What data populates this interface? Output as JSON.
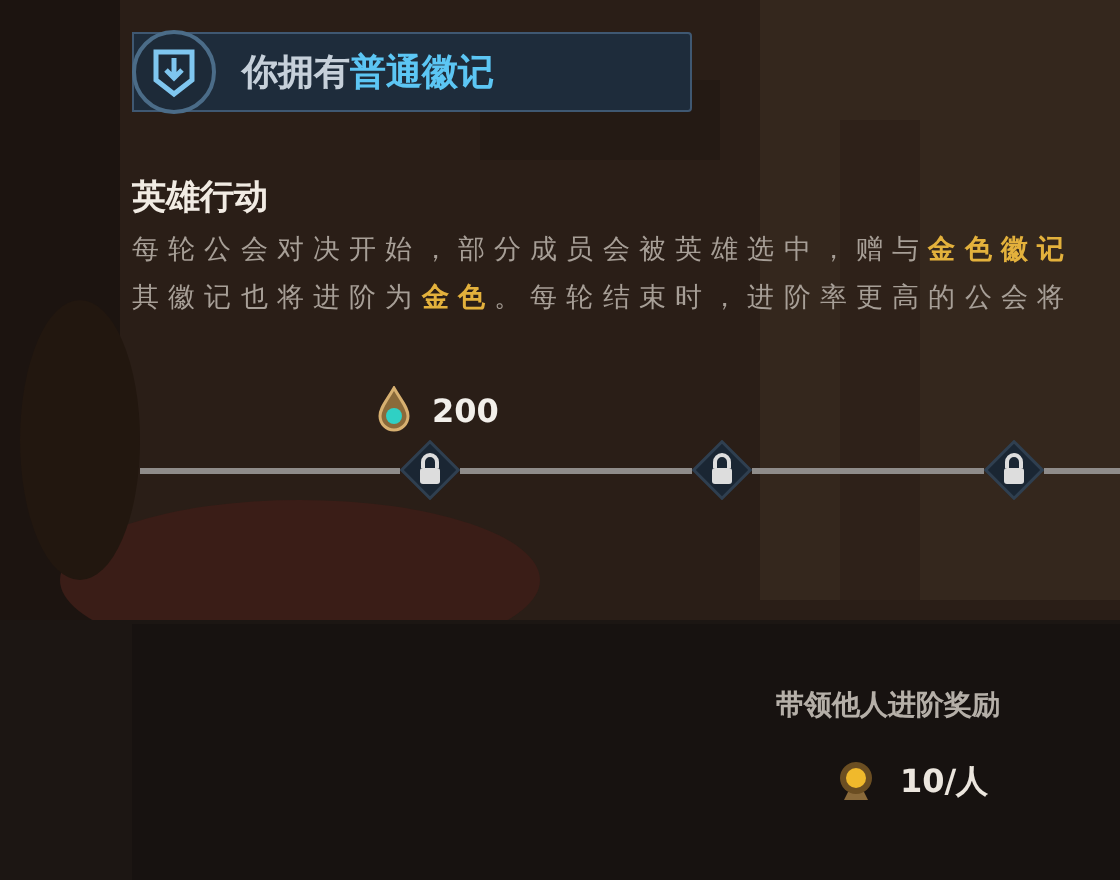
{
  "badge": {
    "text": "你拥有**普通徽记**"
  },
  "section": {
    "title": "英雄行动",
    "description": [
      "每轮公会对决开始，部分成员会被英雄选中，赠与**金色徽记**",
      "其徽记也将进阶为**金色**。每轮结束时，进阶率更高的公会将"
    ]
  },
  "progress": {
    "cost": "200",
    "milestones": [
      {
        "kind": "locked"
      },
      {
        "kind": "locked"
      },
      {
        "kind": "locked"
      }
    ]
  },
  "reward": {
    "title": "带领他人进阶奖励",
    "amount": "10/人"
  }
}
